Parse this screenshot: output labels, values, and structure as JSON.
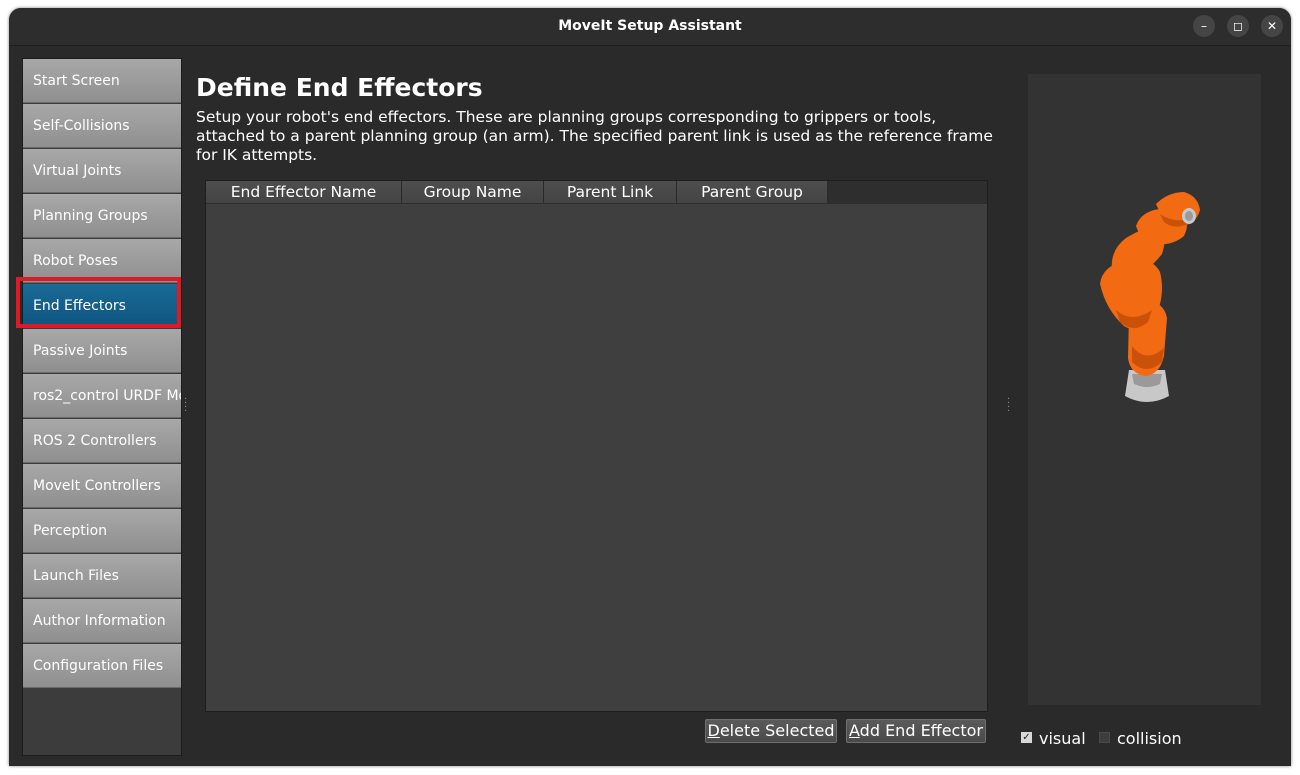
{
  "window": {
    "title": "MoveIt Setup Assistant",
    "controls": [
      "–",
      "◻",
      "✕"
    ]
  },
  "sidebar": {
    "items": [
      {
        "label": "Start Screen"
      },
      {
        "label": "Self-Collisions"
      },
      {
        "label": "Virtual Joints"
      },
      {
        "label": "Planning Groups"
      },
      {
        "label": "Robot Poses"
      },
      {
        "label": "End Effectors",
        "active": true
      },
      {
        "label": "Passive Joints"
      },
      {
        "label": "ros2_control URDF Mo"
      },
      {
        "label": "ROS 2 Controllers"
      },
      {
        "label": "MoveIt Controllers"
      },
      {
        "label": "Perception"
      },
      {
        "label": "Launch Files"
      },
      {
        "label": "Author Information"
      },
      {
        "label": "Configuration Files"
      }
    ]
  },
  "main": {
    "title": "Define End Effectors",
    "description": "Setup your robot's end effectors. These are planning groups corresponding to grippers or tools, attached to a parent planning group (an arm). The specified parent link is used as the reference frame for IK attempts.",
    "table": {
      "columns": [
        "End Effector Name",
        "Group Name",
        "Parent Link",
        "Parent Group"
      ],
      "rows": []
    },
    "buttons": {
      "delete_label": "Delete Selected",
      "delete_mnemonic": "D",
      "delete_rest": "elete Selected",
      "add_label": "Add End Effector",
      "add_mnemonic": "A",
      "add_rest": "dd End Effector"
    }
  },
  "viewer": {
    "visual_label": "visual",
    "visual_checked": true,
    "collision_label": "collision",
    "collision_checked": false,
    "colors": {
      "robot": "#f26a12",
      "base": "#c8c8c8"
    }
  },
  "colors": {
    "accent": "#0e5580",
    "highlight": "#e01a24"
  }
}
